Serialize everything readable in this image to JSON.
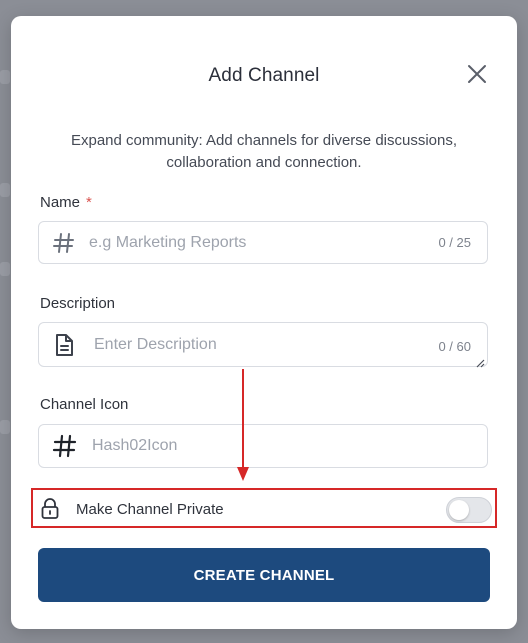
{
  "modal": {
    "title": "Add Channel",
    "subtitle": "Expand community: Add channels for diverse discussions, collaboration and connection."
  },
  "name_field": {
    "label": "Name",
    "required_mark": "*",
    "placeholder": "e.g Marketing Reports",
    "value": "",
    "counter": "0 / 25",
    "icon": "hash-icon"
  },
  "description_field": {
    "label": "Description",
    "placeholder": "Enter Description",
    "value": "",
    "counter": "0 / 60",
    "icon": "document-icon"
  },
  "channel_icon_field": {
    "label": "Channel Icon",
    "placeholder": "Hash02Icon",
    "value": "",
    "icon": "hash-icon"
  },
  "private_toggle": {
    "label": "Make Channel Private",
    "enabled": false,
    "icon": "lock-icon"
  },
  "submit": {
    "label": "CREATE CHANNEL"
  },
  "colors": {
    "accent": "#1d4a7e",
    "highlight": "#d62828",
    "required": "#d9534f"
  }
}
